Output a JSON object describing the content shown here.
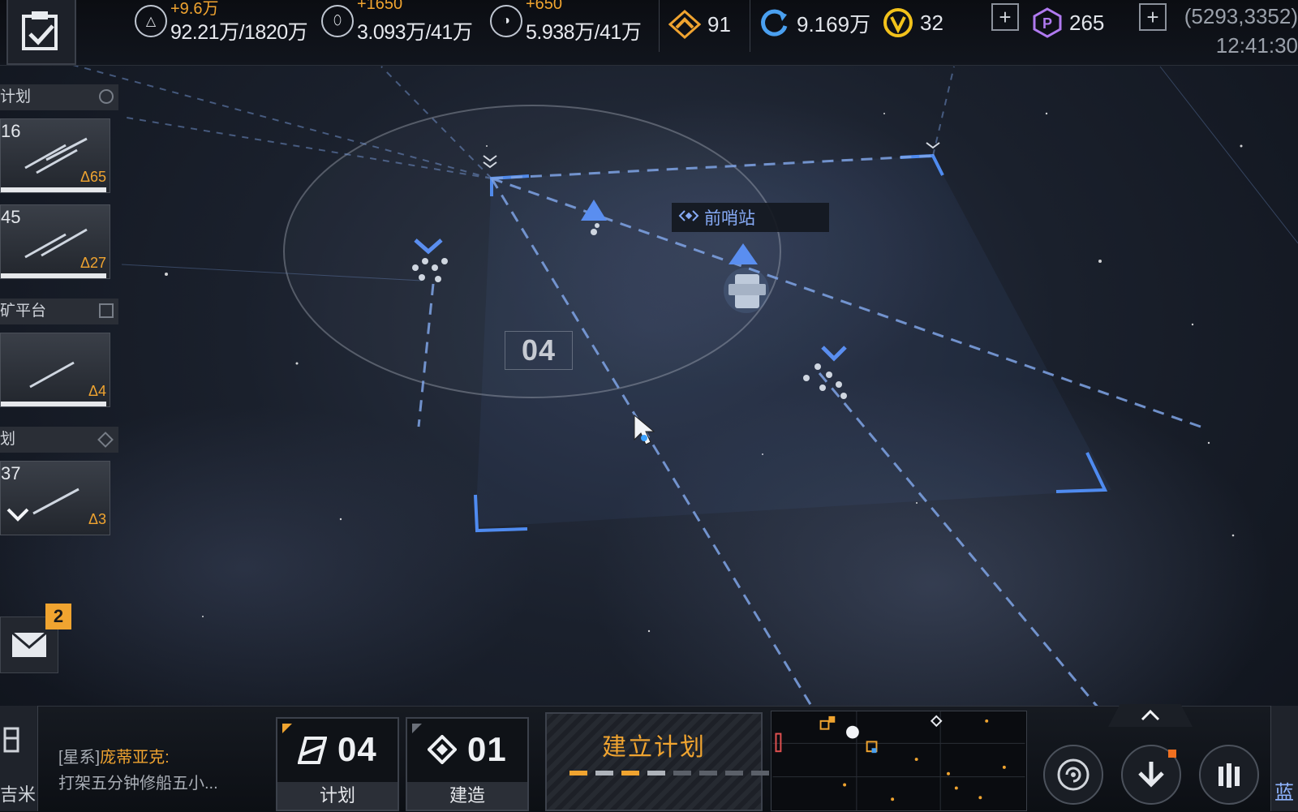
{
  "topbar": {
    "resources": [
      {
        "icon": "triangle-ore-icon",
        "delta": "+9.6万",
        "value": "92.21万/1820万"
      },
      {
        "icon": "crystal-icon",
        "delta": "+1650",
        "value": "3.093万/41万"
      },
      {
        "icon": "gas-orb-icon",
        "delta": "+650",
        "value": "5.938万/41万"
      }
    ],
    "rank_value": "91",
    "energy_value": "9.169万",
    "gold_value": "32",
    "premium_value": "265",
    "coords": "(5293,3352)",
    "time": "12:41:30"
  },
  "left_panel": {
    "sections": [
      {
        "header": "计划",
        "mark": "round",
        "cards": [
          {
            "count": "16",
            "delta": "Δ65"
          },
          {
            "count": "45",
            "delta": "Δ27"
          }
        ]
      },
      {
        "header": "矿平台",
        "mark": "square",
        "cards": [
          {
            "count": "",
            "delta": "Δ4"
          }
        ]
      },
      {
        "header": "划",
        "mark": "diamond",
        "cards": [
          {
            "count": "37",
            "delta": "Δ3"
          }
        ]
      }
    ]
  },
  "mail": {
    "badge": "2"
  },
  "map": {
    "sector_label": "04",
    "outpost_label": "前哨站"
  },
  "chat": {
    "channel": "[星系]",
    "sender": "庞蒂亚克:",
    "message": "打架五分钟修船五小..."
  },
  "left_block_text": "吉米",
  "actions": {
    "plan": {
      "count": "04",
      "label": "计划"
    },
    "build": {
      "count": "01",
      "label": "建造"
    },
    "create_plan": "建立计划"
  },
  "right_block_text": "蓝",
  "colors": {
    "accent": "#f0a430",
    "blue": "#5a8ef0",
    "panel": "#1b1f26"
  }
}
